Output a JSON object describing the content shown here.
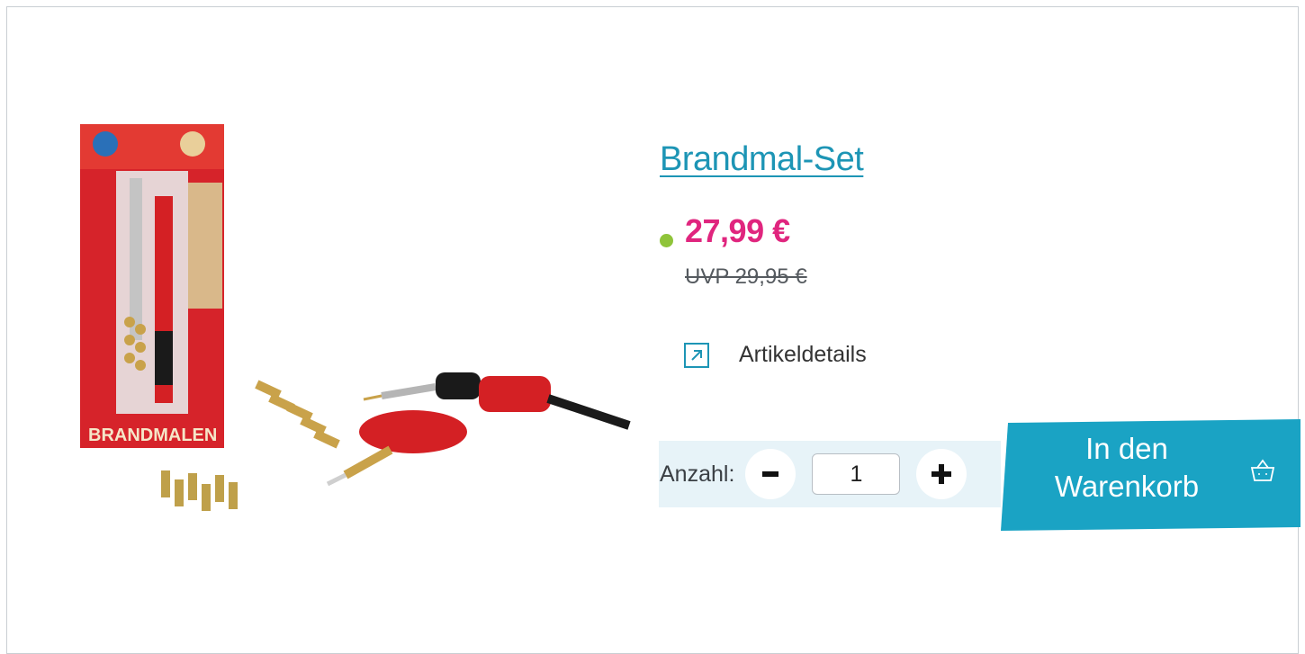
{
  "product": {
    "title": "Brandmal-Set",
    "price": "27,99 €",
    "uvp": "UVP 29,95 €",
    "stock_color": "#8fc43a",
    "image_icon": "product-image"
  },
  "details": {
    "label": "Artikeldetails",
    "icon": "external-link-arrow-icon"
  },
  "quantity": {
    "label": "Anzahl:",
    "value": "1",
    "minus_icon": "minus-icon",
    "plus_icon": "plus-icon"
  },
  "cart": {
    "label": "In den\nWarenkorb",
    "icon": "basket-icon",
    "color": "#1aa3c4"
  },
  "image": {
    "box_brand": "BRANDMALEN"
  },
  "colors": {
    "accent": "#1d95b5",
    "price": "#e0257e",
    "stock": "#8fc43a"
  }
}
